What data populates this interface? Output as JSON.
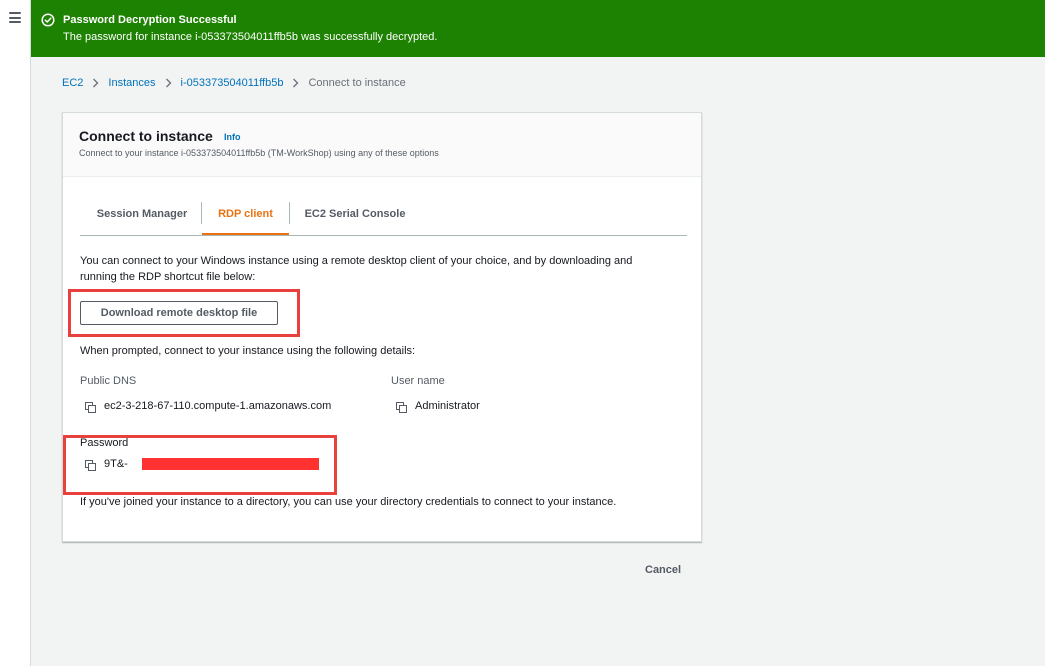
{
  "flash": {
    "title": "Password Decryption Successful",
    "message": "The password for instance i-053373504011ffb5b was successfully decrypted.",
    "color": "#1d8102"
  },
  "breadcrumb": {
    "items": [
      "EC2",
      "Instances",
      "i-053373504011ffb5b"
    ],
    "current": "Connect to instance"
  },
  "panel": {
    "title": "Connect to instance",
    "info_label": "Info",
    "description": "Connect to your instance i-053373504011ffb5b (TM-WorkShop) using any of these options"
  },
  "tabs": [
    {
      "label": "Session Manager",
      "active": false
    },
    {
      "label": "RDP client",
      "active": true
    },
    {
      "label": "EC2 Serial Console",
      "active": false
    }
  ],
  "rdp": {
    "intro_line1": "You can connect to your Windows instance using a remote desktop client of your choice, and by downloading and",
    "intro_line2": "running the RDP shortcut file below:",
    "download_label": "Download remote desktop file",
    "prompt_text": "When prompted, connect to your instance using the following details:",
    "public_dns_label": "Public DNS",
    "public_dns_value": "ec2-3-218-67-110.compute-1.amazonaws.com",
    "username_label": "User name",
    "username_value": "Administrator",
    "password_label": "Password",
    "password_value": "9T&-",
    "directory_note": "If you've joined your instance to a directory, you can use your directory credentials to connect to your instance."
  },
  "footer": {
    "cancel_label": "Cancel"
  },
  "colors": {
    "accent_tab": "#ec7211",
    "link": "#0073bb",
    "highlight": "#e8403c"
  }
}
